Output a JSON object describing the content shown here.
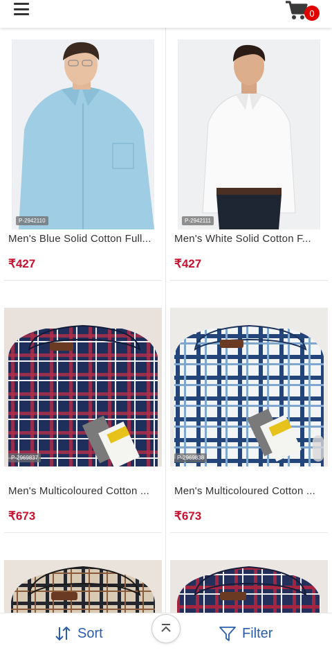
{
  "header": {
    "menu_icon": "hamburger-menu-icon",
    "cart_icon": "shopping-cart-icon",
    "cart_count": "0"
  },
  "products": [
    {
      "sku": "P-2942110",
      "title": "Men's Blue Solid Cotton Full...",
      "price": "₹427",
      "image": "man-light-blue-shirt"
    },
    {
      "sku": "P-2942111",
      "title": "Men's White Solid Cotton F...",
      "price": "₹427",
      "image": "man-white-shirt"
    },
    {
      "sku": "P-2969837",
      "title": "Men's Multicoloured Cotton ...",
      "price": "₹673",
      "image": "folded-navy-check-shirt"
    },
    {
      "sku": "P-2969838",
      "title": "Men's Multicoloured Cotton ...",
      "price": "₹673",
      "image": "folded-blue-white-check-shirt"
    },
    {
      "image": "folded-beige-check-shirt"
    },
    {
      "image": "folded-red-navy-check-shirt"
    }
  ],
  "bottom_bar": {
    "sort_label": "Sort",
    "filter_label": "Filter",
    "sort_icon": "sort-arrows-icon",
    "filter_icon": "funnel-icon",
    "scroll_top_icon": "scroll-to-top-icon"
  },
  "colors": {
    "price": "#c8102e",
    "accent": "#2a5dab",
    "badge": "#e00000"
  }
}
